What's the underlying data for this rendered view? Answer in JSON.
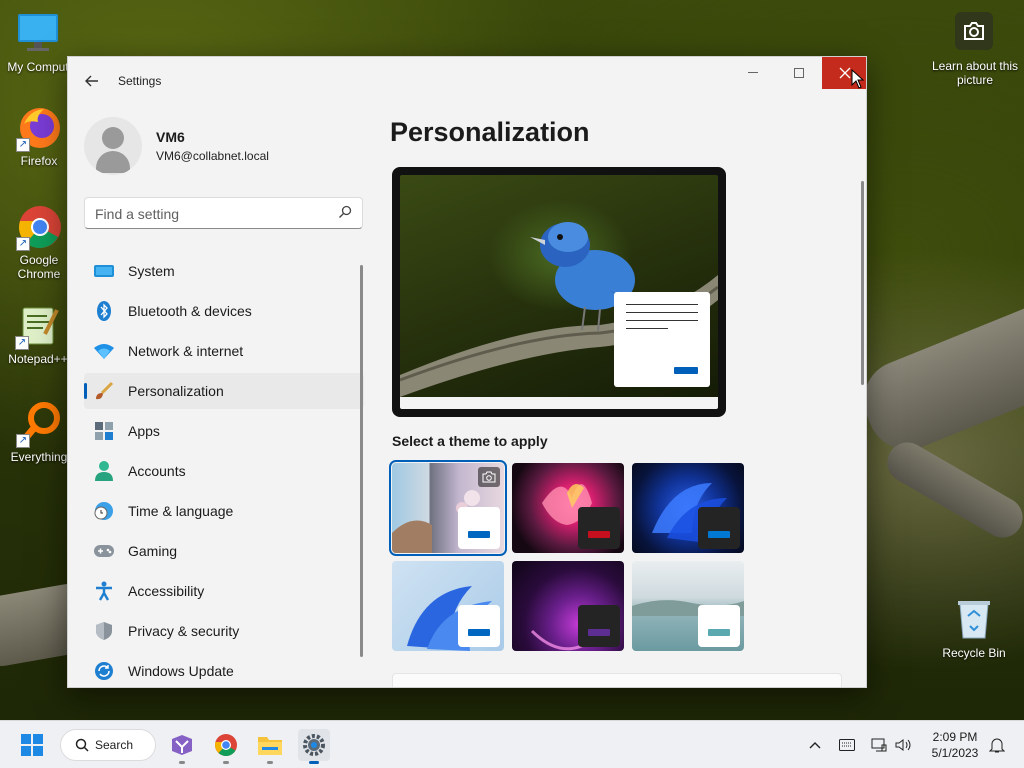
{
  "desktop": {
    "icons": [
      {
        "label": "My Comput"
      },
      {
        "label": "Firefox"
      },
      {
        "label": "Google Chrome"
      },
      {
        "label": "Notepad++"
      },
      {
        "label": "Everything"
      }
    ],
    "learn_label": "Learn about this picture",
    "recycle_label": "Recycle Bin"
  },
  "window": {
    "title": "Settings",
    "profile": {
      "name": "VM6",
      "email": "VM6@collabnet.local"
    },
    "search_placeholder": "Find a setting",
    "nav": [
      {
        "label": "System",
        "icon": "monitor-icon"
      },
      {
        "label": "Bluetooth & devices",
        "icon": "bluetooth-icon"
      },
      {
        "label": "Network & internet",
        "icon": "wifi-icon"
      },
      {
        "label": "Personalization",
        "icon": "brush-icon",
        "selected": true
      },
      {
        "label": "Apps",
        "icon": "apps-icon"
      },
      {
        "label": "Accounts",
        "icon": "person-icon"
      },
      {
        "label": "Time & language",
        "icon": "globe-clock-icon"
      },
      {
        "label": "Gaming",
        "icon": "gamepad-icon"
      },
      {
        "label": "Accessibility",
        "icon": "accessibility-icon"
      },
      {
        "label": "Privacy & security",
        "icon": "shield-icon"
      },
      {
        "label": "Windows Update",
        "icon": "update-icon"
      }
    ],
    "page_title": "Personalization",
    "themes_label": "Select a theme to apply",
    "colors": {
      "accent": "#005fb8",
      "close": "#c42b1c"
    }
  },
  "taskbar": {
    "search_label": "Search",
    "time": "2:09 PM",
    "date": "5/1/2023"
  }
}
